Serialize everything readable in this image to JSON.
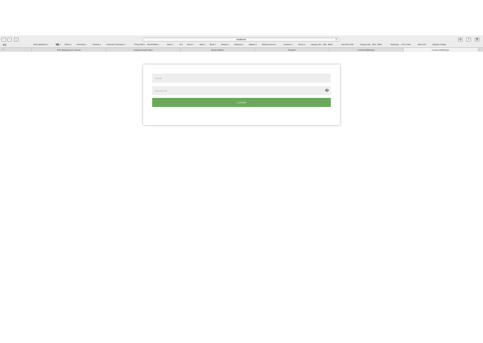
{
  "browser": {
    "window_title": "localhost",
    "toolbar_glyphs": {
      "back": "‹",
      "forward": "›",
      "sidebar": "▯",
      "reload": "↻",
      "extension": "✿",
      "share": "⇧",
      "tabs": "⧉"
    },
    "bookmarks": [
      "Work Hackathon ▾",
      "B▌▌ ▾",
      "Places ▾",
      "Interesting ▾",
      "Climbing ▾",
      "Computer Techniques ▾",
      "Things Will & ... Should Make ▾",
      "Austin ▾",
      "Art ▾",
      "Server ▾",
      "Ideas ▾",
      "Music ▾",
      "Recipes ▾",
      "Shopping ▾",
      "Religion ▾",
      "Writing Sources ▾",
      "Literature ▾",
      "Fitness ▾",
      "Category:Ide... Wiki - Wikia",
      "Asynchro Chat!",
      "Category:Ide... Wiki - Wikia",
      "Slopestyle — The K Files",
      "Add to List",
      "Gapoltus College"
    ],
    "tabs": [
      {
        "label": "OCS Management Console",
        "active": false
      },
      {
        "label": "mrSpamming/Problem",
        "active": false
      },
      {
        "label": "ReadmeOfFun",
        "active": false
      },
      {
        "label": "Shodash",
        "active": false
      },
      {
        "label": "localhost:8000/login",
        "active": false
      },
      {
        "label": "localhost:8000/login",
        "active": true
      }
    ],
    "tab_add": "+"
  },
  "login_form": {
    "email_placeholder": "email",
    "password_placeholder": "password",
    "login_label": "LOGIN",
    "signup_prompt": "",
    "signup_link": ""
  },
  "colors": {
    "primary_button": "#6aa95c",
    "field_background": "#eeeeee"
  }
}
